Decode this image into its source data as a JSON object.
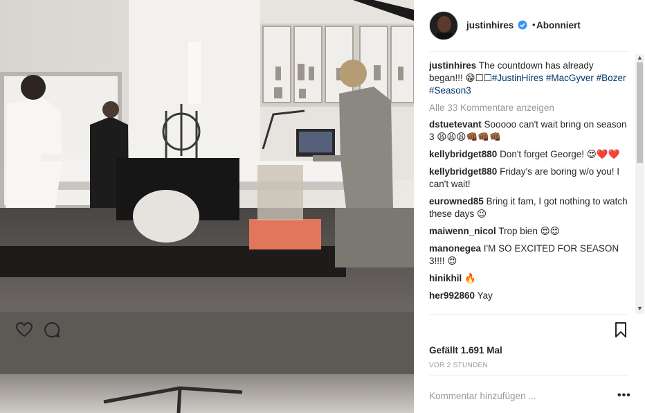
{
  "post": {
    "author": {
      "username": "justinhires",
      "verified": true,
      "follow_state": "Abonniert",
      "separator": "•"
    },
    "caption": {
      "username": "justinhires",
      "text": "The countdown has already began!!! 😁☐☐",
      "hashtags": [
        "#JustinHires",
        "#MacGyver",
        "#Bozer",
        "#Season3"
      ]
    },
    "view_all_comments": "Alle 33 Kommentare anzeigen",
    "comments": [
      {
        "username": "dstuetevant",
        "text": "Sooooo can't wait bring on season 3 😩😩😩👊🏾👊🏾👊🏾"
      },
      {
        "username": "kellybridget880",
        "text": "Don't forget George! 😍❤️❤️"
      },
      {
        "username": "kellybridget880",
        "text": "Friday's are boring w/o you! I can't wait!"
      },
      {
        "username": "eurowned85",
        "text": "Bring it fam, I got nothing to watch these days 😉"
      },
      {
        "username": "maiwenn_nicol",
        "text": "Trop bien 😍😍"
      },
      {
        "username": "manonegea",
        "text": "I'M SO EXCITED FOR SEASON 3!!!! 😍"
      },
      {
        "username": "hinikhil",
        "text": "🔥"
      },
      {
        "username": "her992860",
        "text": "Yay"
      }
    ],
    "likes": "Gefällt 1.691 Mal",
    "timestamp": "VOR 2 STUNDEN",
    "comment_placeholder": "Kommentar hinzufügen ...",
    "more_label": "•••",
    "icons": {
      "like": "heart-icon",
      "comment": "comment-bubble-icon",
      "save": "bookmark-icon",
      "verified": "verified-badge-icon"
    },
    "colors": {
      "text": "#262626",
      "muted": "#999999",
      "hashtag": "#003569",
      "verified": "#3897f0"
    }
  }
}
